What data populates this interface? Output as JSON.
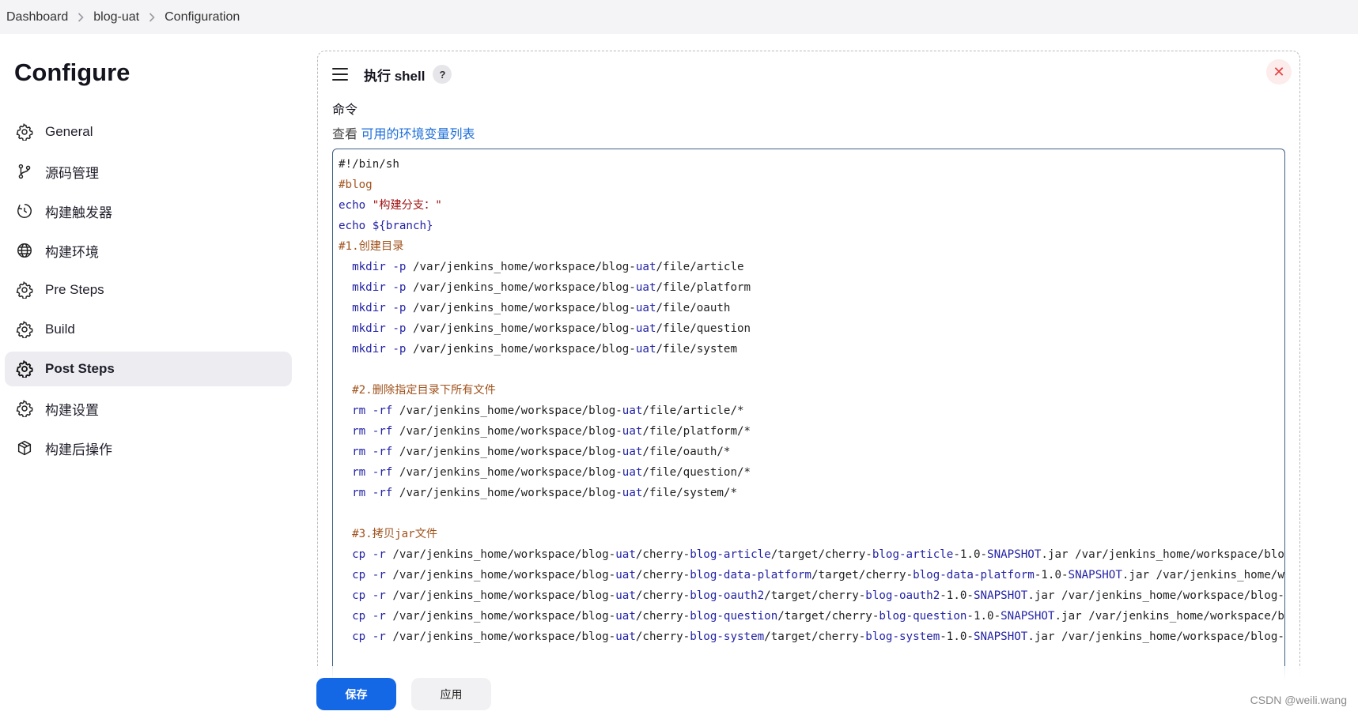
{
  "breadcrumb": {
    "items": [
      "Dashboard",
      "blog-uat",
      "Configuration"
    ]
  },
  "page": {
    "title": "Configure"
  },
  "sidebar": {
    "items": [
      {
        "label": "General",
        "icon": "gear-icon"
      },
      {
        "label": "源码管理",
        "icon": "branch-icon"
      },
      {
        "label": "构建触发器",
        "icon": "timer-icon"
      },
      {
        "label": "构建环境",
        "icon": "globe-icon"
      },
      {
        "label": "Pre Steps",
        "icon": "gear-icon"
      },
      {
        "label": "Build",
        "icon": "gear-icon"
      },
      {
        "label": "Post Steps",
        "icon": "gear-icon",
        "active": true
      },
      {
        "label": "构建设置",
        "icon": "gear-icon"
      },
      {
        "label": "构建后操作",
        "icon": "package-icon"
      }
    ]
  },
  "section": {
    "title": "执行 shell",
    "help": "?",
    "close": "✕",
    "command_label": "命令",
    "env_prefix": "查看 ",
    "env_link": "可用的环境变量列表"
  },
  "code_lines": [
    [
      {
        "t": "#!/bin/sh",
        "c": "def"
      }
    ],
    [
      {
        "t": "#blog",
        "c": "cm"
      }
    ],
    [
      {
        "t": "echo ",
        "c": "kw"
      },
      {
        "t": "\"构建分支：\"",
        "c": "str"
      }
    ],
    [
      {
        "t": "echo ",
        "c": "kw"
      },
      {
        "t": "${branch}",
        "c": "var"
      }
    ],
    [
      {
        "t": "#1.创建目录",
        "c": "cm"
      }
    ],
    [
      {
        "t": "  "
      },
      {
        "t": "mkdir",
        "c": "kw"
      },
      {
        "t": " -p",
        "c": "hl"
      },
      {
        "t": " /var/jenkins_home/workspace/blog-"
      },
      {
        "t": "uat",
        "c": "hl"
      },
      {
        "t": "/file/article"
      }
    ],
    [
      {
        "t": "  "
      },
      {
        "t": "mkdir",
        "c": "kw"
      },
      {
        "t": " -p",
        "c": "hl"
      },
      {
        "t": " /var/jenkins_home/workspace/blog-"
      },
      {
        "t": "uat",
        "c": "hl"
      },
      {
        "t": "/file/platform"
      }
    ],
    [
      {
        "t": "  "
      },
      {
        "t": "mkdir",
        "c": "kw"
      },
      {
        "t": " -p",
        "c": "hl"
      },
      {
        "t": " /var/jenkins_home/workspace/blog-"
      },
      {
        "t": "uat",
        "c": "hl"
      },
      {
        "t": "/file/oauth"
      }
    ],
    [
      {
        "t": "  "
      },
      {
        "t": "mkdir",
        "c": "kw"
      },
      {
        "t": " -p",
        "c": "hl"
      },
      {
        "t": " /var/jenkins_home/workspace/blog-"
      },
      {
        "t": "uat",
        "c": "hl"
      },
      {
        "t": "/file/question"
      }
    ],
    [
      {
        "t": "  "
      },
      {
        "t": "mkdir",
        "c": "kw"
      },
      {
        "t": " -p",
        "c": "hl"
      },
      {
        "t": " /var/jenkins_home/workspace/blog-"
      },
      {
        "t": "uat",
        "c": "hl"
      },
      {
        "t": "/file/system"
      }
    ],
    [
      {
        "t": ""
      }
    ],
    [
      {
        "t": "  "
      },
      {
        "t": "#2.删除指定目录下所有文件",
        "c": "cm"
      }
    ],
    [
      {
        "t": "  "
      },
      {
        "t": "rm",
        "c": "kw"
      },
      {
        "t": " -rf",
        "c": "hl"
      },
      {
        "t": " /var/jenkins_home/workspace/blog-"
      },
      {
        "t": "uat",
        "c": "hl"
      },
      {
        "t": "/file/article/*"
      }
    ],
    [
      {
        "t": "  "
      },
      {
        "t": "rm",
        "c": "kw"
      },
      {
        "t": " -rf",
        "c": "hl"
      },
      {
        "t": " /var/jenkins_home/workspace/blog-"
      },
      {
        "t": "uat",
        "c": "hl"
      },
      {
        "t": "/file/platform/*"
      }
    ],
    [
      {
        "t": "  "
      },
      {
        "t": "rm",
        "c": "kw"
      },
      {
        "t": " -rf",
        "c": "hl"
      },
      {
        "t": " /var/jenkins_home/workspace/blog-"
      },
      {
        "t": "uat",
        "c": "hl"
      },
      {
        "t": "/file/oauth/*"
      }
    ],
    [
      {
        "t": "  "
      },
      {
        "t": "rm",
        "c": "kw"
      },
      {
        "t": " -rf",
        "c": "hl"
      },
      {
        "t": " /var/jenkins_home/workspace/blog-"
      },
      {
        "t": "uat",
        "c": "hl"
      },
      {
        "t": "/file/question/*"
      }
    ],
    [
      {
        "t": "  "
      },
      {
        "t": "rm",
        "c": "kw"
      },
      {
        "t": " -rf",
        "c": "hl"
      },
      {
        "t": " /var/jenkins_home/workspace/blog-"
      },
      {
        "t": "uat",
        "c": "hl"
      },
      {
        "t": "/file/system/*"
      }
    ],
    [
      {
        "t": ""
      }
    ],
    [
      {
        "t": "  "
      },
      {
        "t": "#3.拷贝jar文件",
        "c": "cm"
      }
    ],
    [
      {
        "t": "  "
      },
      {
        "t": "cp",
        "c": "kw"
      },
      {
        "t": " -r",
        "c": "hl"
      },
      {
        "t": " /var/jenkins_home/workspace/blog-"
      },
      {
        "t": "uat",
        "c": "hl"
      },
      {
        "t": "/cherry-"
      },
      {
        "t": "blog-article",
        "c": "hl"
      },
      {
        "t": "/target/cherry-"
      },
      {
        "t": "blog-article",
        "c": "hl"
      },
      {
        "t": "-1.0-"
      },
      {
        "t": "SNAPSHOT",
        "c": "hl"
      },
      {
        "t": ".jar /var/jenkins_home/workspace/blog-uat/file/article"
      }
    ],
    [
      {
        "t": "  "
      },
      {
        "t": "cp",
        "c": "kw"
      },
      {
        "t": " -r",
        "c": "hl"
      },
      {
        "t": " /var/jenkins_home/workspace/blog-"
      },
      {
        "t": "uat",
        "c": "hl"
      },
      {
        "t": "/cherry-"
      },
      {
        "t": "blog-data-platform",
        "c": "hl"
      },
      {
        "t": "/target/cherry-"
      },
      {
        "t": "blog-data-platform",
        "c": "hl"
      },
      {
        "t": "-1.0-"
      },
      {
        "t": "SNAPSHOT",
        "c": "hl"
      },
      {
        "t": ".jar /var/jenkins_home/workspace/blog-uat/file/platform"
      }
    ],
    [
      {
        "t": "  "
      },
      {
        "t": "cp",
        "c": "kw"
      },
      {
        "t": " -r",
        "c": "hl"
      },
      {
        "t": " /var/jenkins_home/workspace/blog-"
      },
      {
        "t": "uat",
        "c": "hl"
      },
      {
        "t": "/cherry-"
      },
      {
        "t": "blog-oauth2",
        "c": "hl"
      },
      {
        "t": "/target/cherry-"
      },
      {
        "t": "blog-oauth2",
        "c": "hl"
      },
      {
        "t": "-1.0-"
      },
      {
        "t": "SNAPSHOT",
        "c": "hl"
      },
      {
        "t": ".jar /var/jenkins_home/workspace/blog-uat/file/oauth"
      }
    ],
    [
      {
        "t": "  "
      },
      {
        "t": "cp",
        "c": "kw"
      },
      {
        "t": " -r",
        "c": "hl"
      },
      {
        "t": " /var/jenkins_home/workspace/blog-"
      },
      {
        "t": "uat",
        "c": "hl"
      },
      {
        "t": "/cherry-"
      },
      {
        "t": "blog-question",
        "c": "hl"
      },
      {
        "t": "/target/cherry-"
      },
      {
        "t": "blog-question",
        "c": "hl"
      },
      {
        "t": "-1.0-"
      },
      {
        "t": "SNAPSHOT",
        "c": "hl"
      },
      {
        "t": ".jar /var/jenkins_home/workspace/blog-uat/file/question"
      }
    ],
    [
      {
        "t": "  "
      },
      {
        "t": "cp",
        "c": "kw"
      },
      {
        "t": " -r",
        "c": "hl"
      },
      {
        "t": " /var/jenkins_home/workspace/blog-"
      },
      {
        "t": "uat",
        "c": "hl"
      },
      {
        "t": "/cherry-"
      },
      {
        "t": "blog-system",
        "c": "hl"
      },
      {
        "t": "/target/cherry-"
      },
      {
        "t": "blog-system",
        "c": "hl"
      },
      {
        "t": "-1.0-"
      },
      {
        "t": "SNAPSHOT",
        "c": "hl"
      },
      {
        "t": ".jar /var/jenkins_home/workspace/blog-uat/file/system"
      }
    ]
  ],
  "actions": {
    "save": "保存",
    "apply": "应用"
  },
  "watermark": "CSDN @weili.wang",
  "colors": {
    "accent": "#1468e6",
    "comment": "#a0521c",
    "keyword": "#2323a6",
    "string": "#a11313",
    "close": "#e43d3d"
  }
}
